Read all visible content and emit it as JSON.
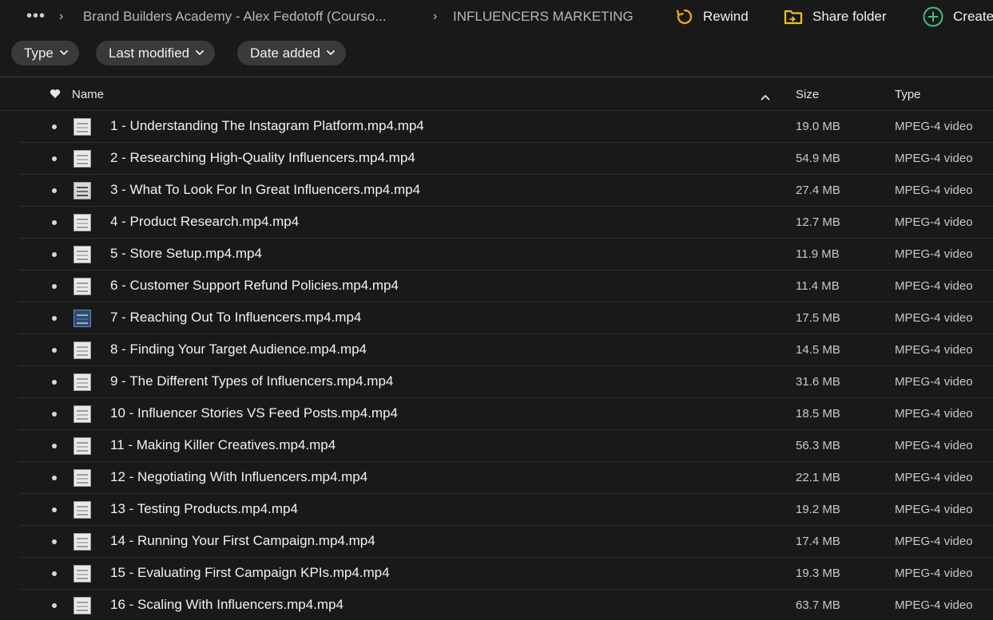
{
  "breadcrumb": {
    "more_label": "•••",
    "items": [
      "Brand Builders Academy - Alex Fedotoff (Courso...",
      "INFLUENCERS MARKETING"
    ]
  },
  "actions": {
    "rewind": "Rewind",
    "share_folder": "Share folder",
    "create": "Create"
  },
  "filters": {
    "type": "Type",
    "last_modified": "Last modified",
    "date_added": "Date added"
  },
  "columns": {
    "name": "Name",
    "size": "Size",
    "type": "Type"
  },
  "colors": {
    "rewind_icon": "#f0a020",
    "share_icon": "#f0c020",
    "create_icon": "#3fbf7f"
  },
  "files": [
    {
      "name": "1 - Understanding The Instagram Platform.mp4.mp4",
      "size": "19.0 MB",
      "type": "MPEG-4 video",
      "thumb": "doc"
    },
    {
      "name": "2 - Researching High-Quality Influencers.mp4.mp4",
      "size": "54.9 MB",
      "type": "MPEG-4 video",
      "thumb": "doc"
    },
    {
      "name": "3 - What To Look For In Great Influencers.mp4.mp4",
      "size": "27.4 MB",
      "type": "MPEG-4 video",
      "thumb": "grid"
    },
    {
      "name": "4 - Product Research.mp4.mp4",
      "size": "12.7 MB",
      "type": "MPEG-4 video",
      "thumb": "doc"
    },
    {
      "name": "5 - Store Setup.mp4.mp4",
      "size": "11.9 MB",
      "type": "MPEG-4 video",
      "thumb": "doc"
    },
    {
      "name": "6 - Customer Support Refund Policies.mp4.mp4",
      "size": "11.4 MB",
      "type": "MPEG-4 video",
      "thumb": "doc"
    },
    {
      "name": "7 - Reaching Out To Influencers.mp4.mp4",
      "size": "17.5 MB",
      "type": "MPEG-4 video",
      "thumb": "dark"
    },
    {
      "name": "8 - Finding Your Target Audience.mp4.mp4",
      "size": "14.5 MB",
      "type": "MPEG-4 video",
      "thumb": "doc"
    },
    {
      "name": "9 - The Different Types of Influencers.mp4.mp4",
      "size": "31.6 MB",
      "type": "MPEG-4 video",
      "thumb": "doc"
    },
    {
      "name": "10 - Influencer Stories VS Feed Posts.mp4.mp4",
      "size": "18.5 MB",
      "type": "MPEG-4 video",
      "thumb": "doc"
    },
    {
      "name": "11 - Making Killer Creatives.mp4.mp4",
      "size": "56.3 MB",
      "type": "MPEG-4 video",
      "thumb": "doc"
    },
    {
      "name": "12 - Negotiating With Influencers.mp4.mp4",
      "size": "22.1 MB",
      "type": "MPEG-4 video",
      "thumb": "doc"
    },
    {
      "name": "13 - Testing Products.mp4.mp4",
      "size": "19.2 MB",
      "type": "MPEG-4 video",
      "thumb": "doc"
    },
    {
      "name": "14 - Running Your First Campaign.mp4.mp4",
      "size": "17.4 MB",
      "type": "MPEG-4 video",
      "thumb": "doc"
    },
    {
      "name": "15 - Evaluating First Campaign KPIs.mp4.mp4",
      "size": "19.3 MB",
      "type": "MPEG-4 video",
      "thumb": "doc"
    },
    {
      "name": "16 - Scaling With Influencers.mp4.mp4",
      "size": "63.7 MB",
      "type": "MPEG-4 video",
      "thumb": "doc"
    }
  ]
}
